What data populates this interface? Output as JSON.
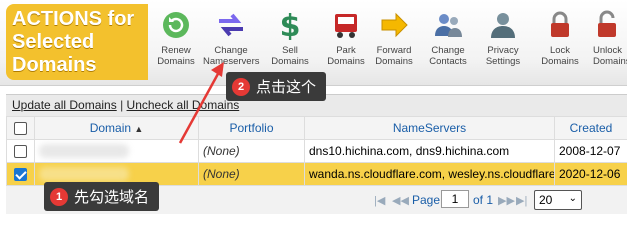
{
  "toolbar": {
    "actions_title": [
      "ACTIONS for",
      "Selected",
      "Domains"
    ],
    "tools": [
      {
        "name": "renew",
        "line1": "Renew",
        "line2": "Domains",
        "icon": "renew-icon",
        "color": "#4caf50"
      },
      {
        "name": "change-nameservers",
        "line1": "Change",
        "line2": "Nameservers",
        "icon": "nameservers-icon",
        "color": "#6a5acd"
      },
      {
        "name": "sell",
        "line1": "Sell",
        "line2": "Domains",
        "icon": "dollar-icon",
        "color": "#2e8b57"
      },
      {
        "name": "park",
        "line1": "Park",
        "line2": "Domains",
        "icon": "truck-icon",
        "color": "#c62828"
      },
      {
        "name": "forward",
        "line1": "Forward",
        "line2": "Domains",
        "icon": "forward-arrow-icon",
        "color": "#f5b800"
      },
      {
        "name": "change-contacts",
        "line1": "Change",
        "line2": "Contacts",
        "icon": "contacts-icon",
        "color": "#4a6fa5"
      },
      {
        "name": "privacy",
        "line1": "Privacy",
        "line2": "Settings",
        "icon": "privacy-icon",
        "color": "#607d8b"
      },
      {
        "name": "lock",
        "line1": "Lock",
        "line2": "Domains",
        "icon": "lock-icon",
        "color": "#c0392b"
      },
      {
        "name": "unlock",
        "line1": "Unlock",
        "line2": "Domains",
        "icon": "unlock-icon",
        "color": "#c0392b"
      }
    ]
  },
  "update_bar": {
    "update_all": "Update all Domains",
    "separator": "|",
    "uncheck_all": "Uncheck all Domains"
  },
  "table": {
    "headers": {
      "domain": "Domain",
      "sort_arrow": "▲",
      "portfolio": "Portfolio",
      "nameservers": "NameServers",
      "created": "Created"
    },
    "rows": [
      {
        "checked": false,
        "portfolio": "(None)",
        "nameservers": "dns10.hichina.com, dns9.hichina.com",
        "created": "2008-12-07"
      },
      {
        "checked": true,
        "portfolio": "(None)",
        "nameservers": "wanda.ns.cloudflare.com, wesley.ns.cloudflare.com",
        "created": "2020-12-06"
      }
    ]
  },
  "pager": {
    "page_label": "Page",
    "page_value": "1",
    "of_label": "of 1",
    "per_page": "20",
    "nav": [
      "|◀",
      "◀◀",
      "▶▶",
      "▶|"
    ]
  },
  "annotations": {
    "step1": {
      "num": "1",
      "text": "先勾选域名"
    },
    "step2": {
      "num": "2",
      "text": "点击这个"
    }
  },
  "colors": {
    "actions_bg": "#f3c12d",
    "selected_row": "#f7d14a",
    "link_blue": "#1a5ea8",
    "annotation_bg": "#3a3a3a",
    "annotation_num": "#e53935"
  }
}
